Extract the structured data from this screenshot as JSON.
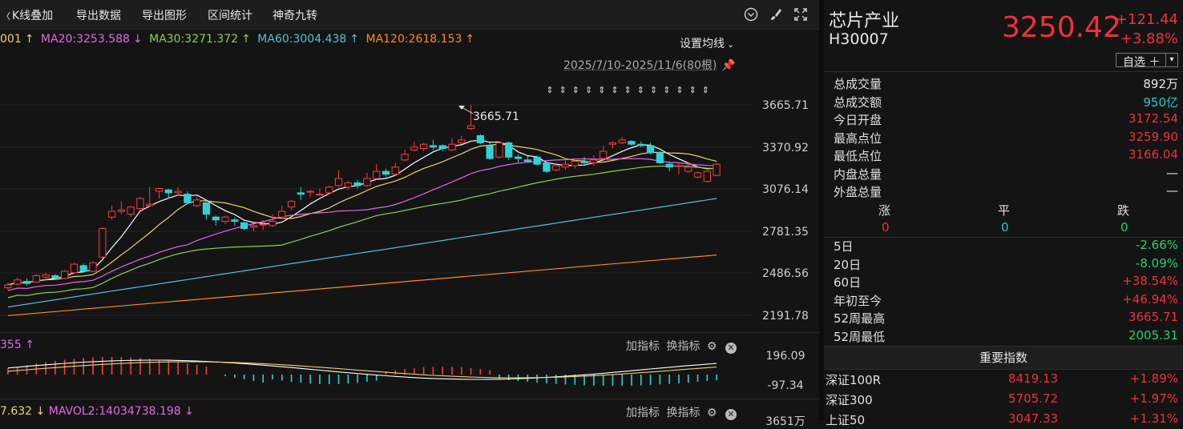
{
  "toolbar": {
    "kline_overlay": "K线叠加",
    "export_data": "导出数据",
    "export_chart": "导出图形",
    "range_stats": "区间统计",
    "magic_nine": "神奇九转"
  },
  "ma": {
    "ma10_tail": "001",
    "ma20": "MA20:3253.588",
    "ma30": "MA30:3271.372",
    "ma60": "MA60:3004.438",
    "ma120": "MA120:2618.153",
    "setting": "设置均线"
  },
  "range_text": "2025/7/10-2025/11/6(80根)",
  "chart_data": {
    "type": "candlestick",
    "y_ticks": [
      "3665.71",
      "3370.92",
      "3076.14",
      "2781.35",
      "2486.56",
      "2191.78"
    ],
    "high_annotation": "3665.71",
    "ylim": [
      2191.78,
      3665.71
    ],
    "colors": {
      "up": "#ff3b3b",
      "down": "#2fd2d9",
      "ma5": "#ffffff",
      "ma10": "#f1d36b",
      "ma20": "#e667e6",
      "ma30": "#8bd14a",
      "ma60": "#4fc3d8",
      "ma120": "#ff8c1a"
    }
  },
  "sub1": {
    "label": "355",
    "top": "196.09",
    "bottom": "-97.34",
    "add_indicator": "加指标",
    "switch_indicator": "换指标"
  },
  "sub2": {
    "label_left": "7.632",
    "label_mavol2": "MAVOL2:14034738.198",
    "add_indicator": "加指标",
    "switch_indicator": "换指标",
    "cut_tick": "3651万"
  },
  "panel": {
    "name": "芯片产业",
    "code": "H30007",
    "price": "3250.42",
    "change": "+121.44",
    "change_pct": "+3.88%",
    "watch_button": "自选 ＋",
    "stats": [
      {
        "k": "总成交量",
        "v": "892万",
        "c": "white"
      },
      {
        "k": "总成交额",
        "v": "950亿",
        "c": "cyan"
      },
      {
        "k": "今日开盘",
        "v": "3172.54",
        "c": "red"
      },
      {
        "k": "最高点位",
        "v": "3259.90",
        "c": "red"
      },
      {
        "k": "最低点位",
        "v": "3166.04",
        "c": "red"
      },
      {
        "k": "内盘总量",
        "v": "—",
        "c": "white"
      },
      {
        "k": "外盘总量",
        "v": "—",
        "c": "white"
      }
    ],
    "updown": {
      "up_label": "涨",
      "flat_label": "平",
      "down_label": "跌",
      "up": "0",
      "flat": "0",
      "down": "0"
    },
    "periods": [
      {
        "k": "5日",
        "v": "-2.66%",
        "c": "green"
      },
      {
        "k": "20日",
        "v": "-8.09%",
        "c": "green"
      },
      {
        "k": "60日",
        "v": "+38.54%",
        "c": "red"
      },
      {
        "k": "年初至今",
        "v": "+46.94%",
        "c": "red"
      },
      {
        "k": "52周最高",
        "v": "3665.71",
        "c": "red"
      },
      {
        "k": "52周最低",
        "v": "2005.31",
        "c": "green"
      }
    ],
    "index_header": "重要指数",
    "indexes": [
      {
        "name": "深证100R",
        "price": "8419.13",
        "pct": "+1.89%"
      },
      {
        "name": "深证300",
        "price": "5705.72",
        "pct": "+1.97%"
      },
      {
        "name": "上证50",
        "price": "3047.33",
        "pct": "+1.31%"
      }
    ]
  }
}
